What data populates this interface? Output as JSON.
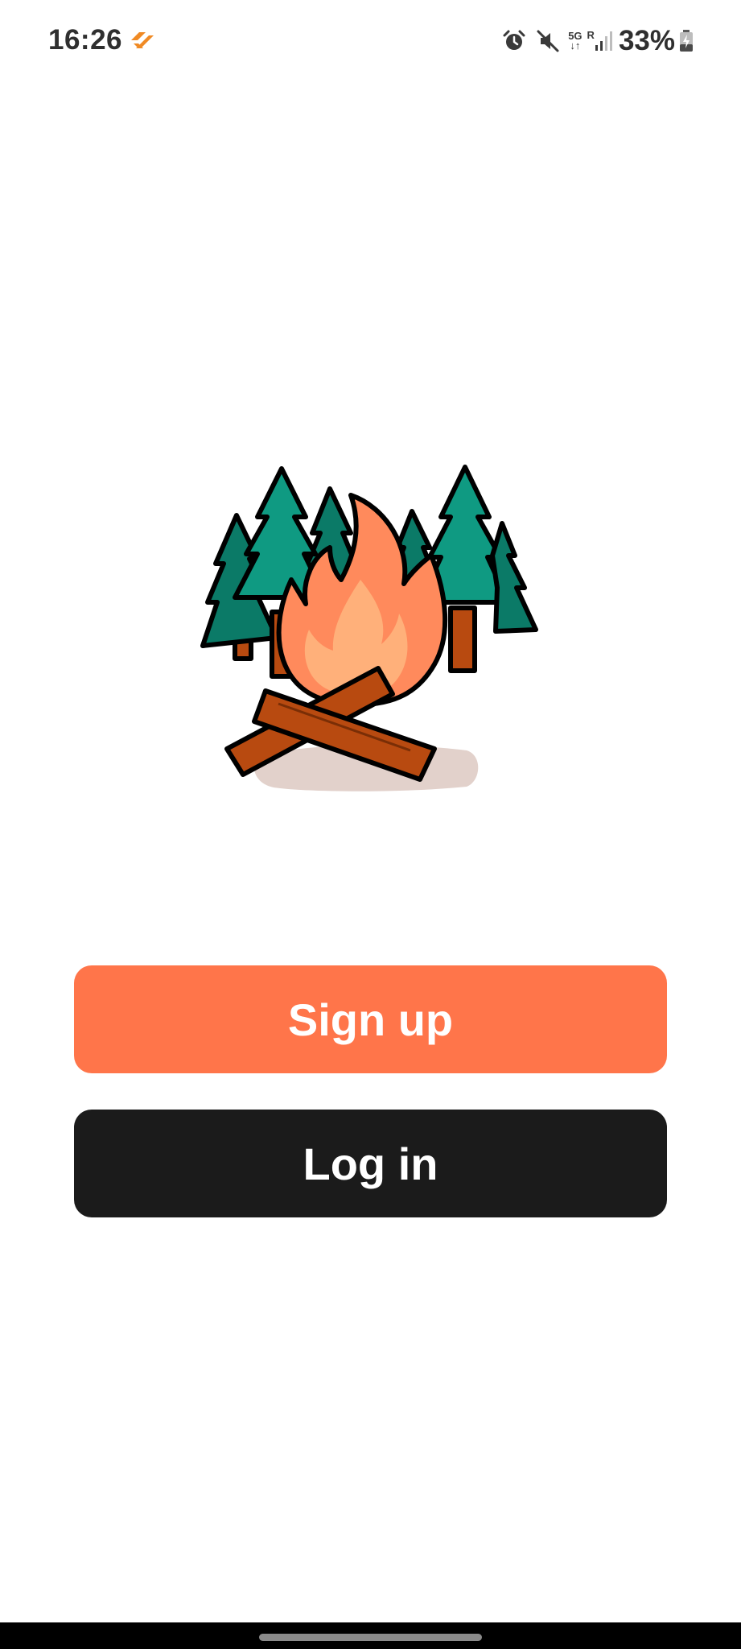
{
  "status_bar": {
    "time": "16:26",
    "network": "5G",
    "roaming": "R",
    "battery": "33%"
  },
  "buttons": {
    "signup_label": "Sign up",
    "login_label": "Log in"
  },
  "colors": {
    "signup_bg": "#ff754a",
    "login_bg": "#1b1b1b",
    "tree_green": "#0f9a82",
    "tree_green_dark": "#0b7a67",
    "flame_orange": "#ff8a5c",
    "flame_light": "#ffb07a",
    "log_brown": "#b84a10",
    "ground_shadow": "#e2d1cb"
  },
  "icons": {
    "notification_app": "orange-app-logo-icon",
    "alarm": "alarm-icon",
    "mute": "mute-icon",
    "signal": "signal-icon",
    "battery": "battery-charging-icon"
  }
}
